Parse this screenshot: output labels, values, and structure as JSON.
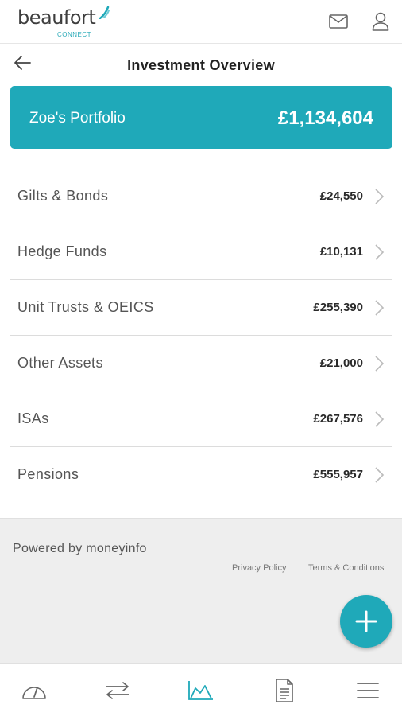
{
  "brand": {
    "name": "beaufort",
    "subtitle": "CONNECT",
    "accent": "#1fa9b9"
  },
  "topbar": {
    "icons": [
      "mail-icon",
      "user-icon"
    ]
  },
  "header": {
    "title": "Investment Overview",
    "back_icon": "arrow-left-icon"
  },
  "portfolio": {
    "name": "Zoe's Portfolio",
    "total": "£1,134,604"
  },
  "holdings": [
    {
      "label": "Gilts & Bonds",
      "value": "£24,550"
    },
    {
      "label": "Hedge Funds",
      "value": "£10,131"
    },
    {
      "label": "Unit Trusts & OEICS",
      "value": "£255,390"
    },
    {
      "label": "Other Assets",
      "value": "£21,000"
    },
    {
      "label": "ISAs",
      "value": "£267,576"
    },
    {
      "label": "Pensions",
      "value": "£555,957"
    }
  ],
  "footer": {
    "powered_by": "Powered by moneyinfo",
    "privacy": "Privacy Policy",
    "terms": "Terms & Conditions"
  },
  "fab": {
    "icon": "plus-icon"
  },
  "bottom_nav": {
    "items": [
      "dashboard-icon",
      "transfer-icon",
      "chart-icon",
      "document-icon",
      "menu-icon"
    ],
    "active": "chart-icon"
  }
}
